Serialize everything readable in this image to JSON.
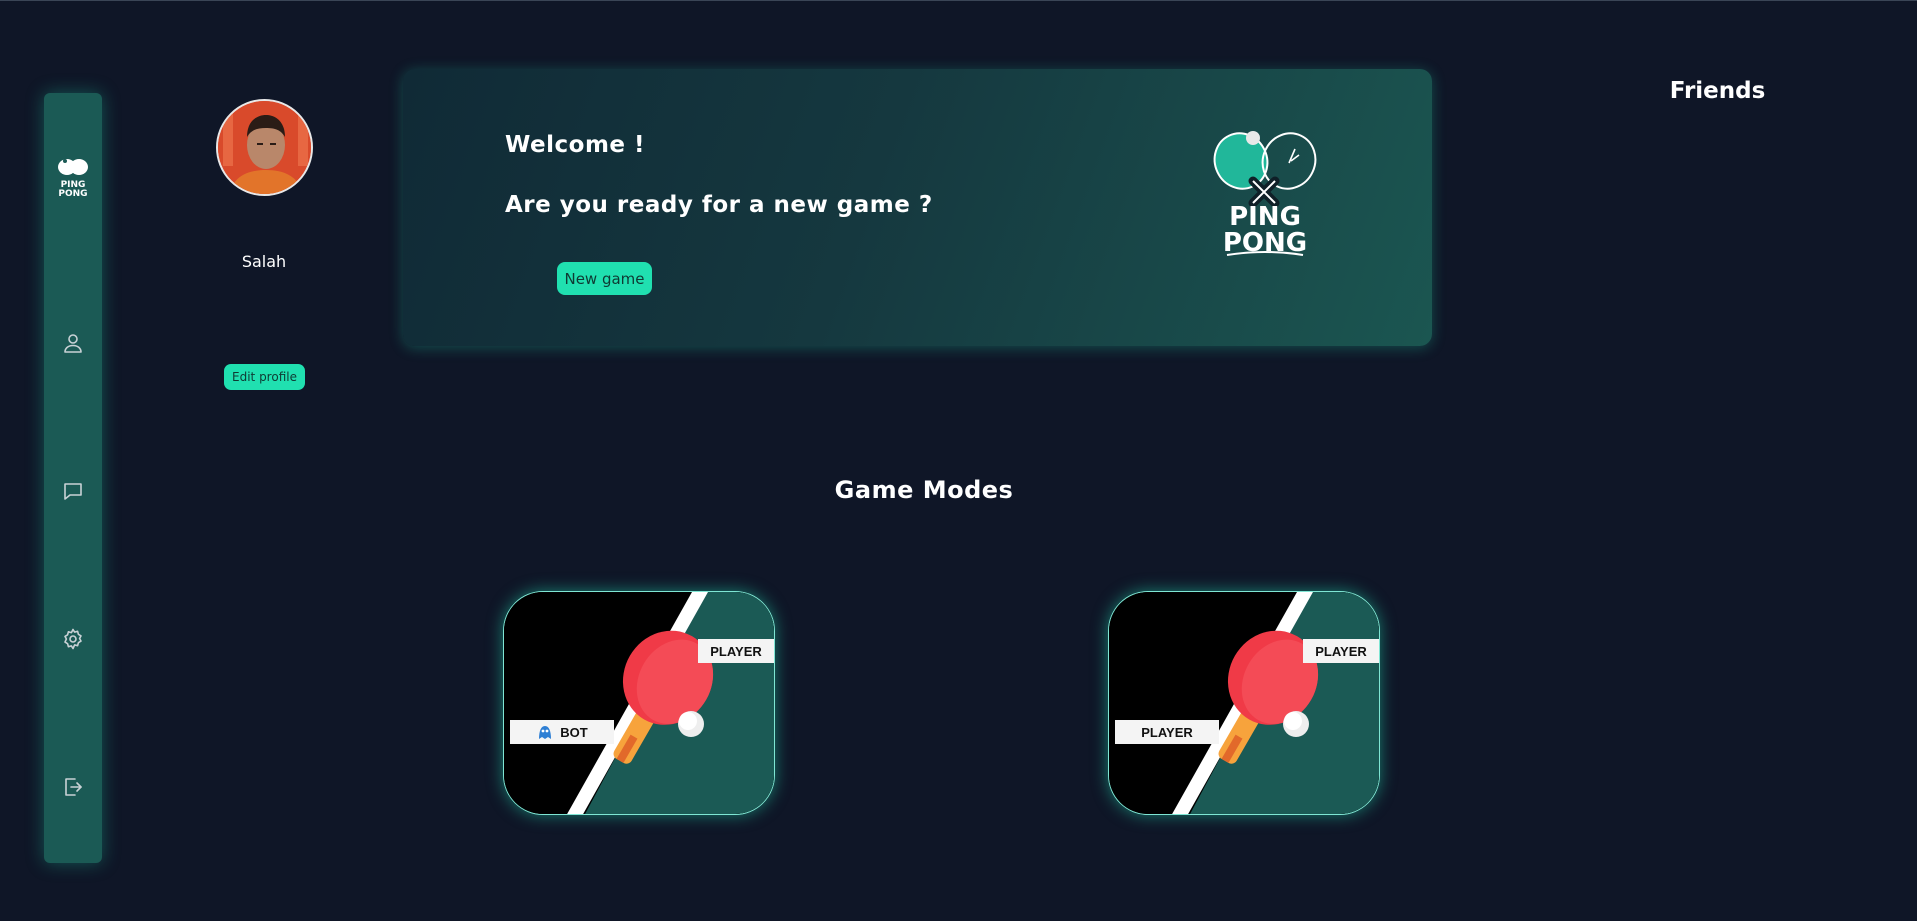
{
  "sidebar": {
    "logo_text": [
      "PING",
      "PONG"
    ],
    "items": [
      {
        "icon": "user-icon"
      },
      {
        "icon": "chat-icon"
      },
      {
        "icon": "gear-icon"
      },
      {
        "icon": "logout-icon"
      }
    ]
  },
  "profile": {
    "name": "Salah",
    "edit_label": "Edit profile"
  },
  "welcome": {
    "title": "Welcome !",
    "subtitle": "Are you ready for a new game ?",
    "button_label": "New game",
    "logo_text": [
      "PING",
      "PONG"
    ]
  },
  "friends": {
    "title": "Friends"
  },
  "game_modes": {
    "title": "Game Modes",
    "modes": [
      {
        "left_label": "BOT",
        "right_label": "PLAYER"
      },
      {
        "left_label": "PLAYER",
        "right_label": "PLAYER"
      }
    ]
  },
  "colors": {
    "background": "#0f1627",
    "accent": "#20e0b0",
    "card_teal": "#1b5a55",
    "paddle_red": "#f03a47"
  }
}
